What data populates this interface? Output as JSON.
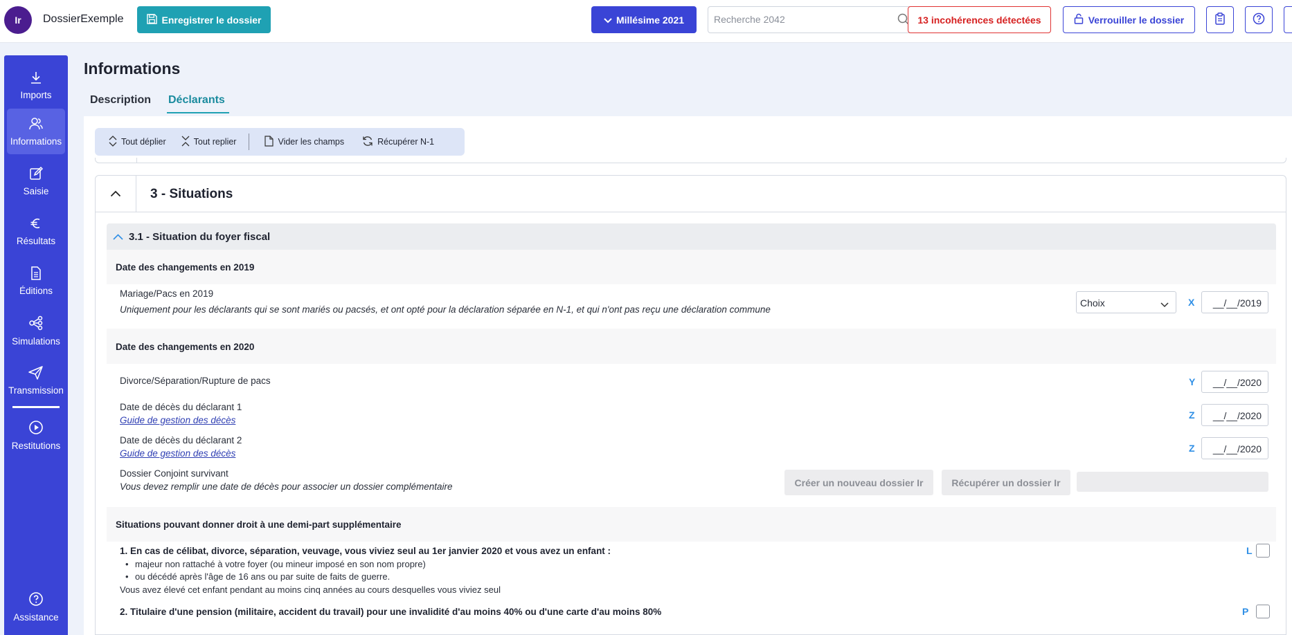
{
  "app": {
    "logo_text": "Ir",
    "name": "DossierExemple",
    "save_label": "Enregistrer le dossier",
    "year_label": "Millésime 2021",
    "search_placeholder": "Recherche 2042",
    "incoherences_label": "13 incohérences détectées",
    "lock_label": "Verrouiller le dossier",
    "accent_color": "#3a44d6",
    "save_color": "#1fa1b3",
    "alert_color": "#d62020"
  },
  "sidebar": {
    "items": [
      {
        "label": "Imports",
        "icon": "download-icon"
      },
      {
        "label": "Informations",
        "icon": "people-icon"
      },
      {
        "label": "Saisie",
        "icon": "edit-icon"
      },
      {
        "label": "Résultats",
        "icon": "euro-icon"
      },
      {
        "label": "Éditions",
        "icon": "document-icon"
      },
      {
        "label": "Simulations",
        "icon": "network-icon"
      },
      {
        "label": "Transmission",
        "icon": "send-icon"
      },
      {
        "label": "Restitutions",
        "icon": "play-icon"
      },
      {
        "label": "Assistance",
        "icon": "help-icon"
      }
    ],
    "active": "Informations"
  },
  "page": {
    "title": "Informations",
    "tabs": [
      {
        "label": "Description"
      },
      {
        "label": "Déclarants"
      }
    ],
    "active_tab": "Déclarants"
  },
  "toolbar": {
    "expand_label": "Tout déplier",
    "collapse_label": "Tout replier",
    "clear_label": "Vider les champs",
    "recover_label": "Récupérer N-1"
  },
  "section": {
    "title": "3 - Situations",
    "subsection_title": "3.1 - Situation du foyer fiscal",
    "group_2019": {
      "title": "Date des changements en 2019",
      "mariage_label": "Mariage/Pacs en 2019",
      "mariage_note": "Uniquement pour les déclarants qui se sont mariés ou pacsés, et ont opté pour la déclaration séparée en N-1, et qui n'ont pas reçu une déclaration commune",
      "select_value": "Choix",
      "mariage_letter": "X",
      "mariage_date": "__/__/2019"
    },
    "group_2020": {
      "title": "Date des changements en 2020",
      "divorce_label": "Divorce/Séparation/Rupture de pacs",
      "divorce_letter": "Y",
      "divorce_date": "__/__/2020",
      "deces1_label": "Date de décès du déclarant 1",
      "deces1_link": "Guide de gestion des décès",
      "deces1_letter": "Z",
      "deces1_date": "__/__/2020",
      "deces2_label": "Date de décès du déclarant 2",
      "deces2_link": "Guide de gestion des décès",
      "deces2_letter": "Z",
      "deces2_date": "__/__/2020",
      "conjoint_label": "Dossier Conjoint survivant",
      "conjoint_note": "Vous devez remplir une date de décès pour associer un dossier complémentaire",
      "create_label": "Créer un nouveau dossier Ir",
      "recover_label": "Récupérer un dossier Ir"
    },
    "group_demi_part": {
      "title": "Situations pouvant donner droit à une demi-part supplémentaire",
      "item1_title": "1. En cas de célibat, divorce, séparation, veuvage, vous viviez seul au 1er janvier 2020 et vous avez un enfant :",
      "item1_bullet1": "majeur non rattaché à votre foyer (ou mineur imposé en son nom propre)",
      "item1_bullet2": "ou décédé après l'âge de 16 ans ou par suite de faits de guerre.",
      "item1_note": "Vous avez élevé cet enfant pendant au moins cinq années au cours desquelles vous viviez seul",
      "item1_letter": "L",
      "item2_title": "2. Titulaire d'une pension (militaire, accident du travail) pour une invalidité d'au moins 40% ou d'une carte d'au moins 80%",
      "item2_letter": "P"
    }
  }
}
